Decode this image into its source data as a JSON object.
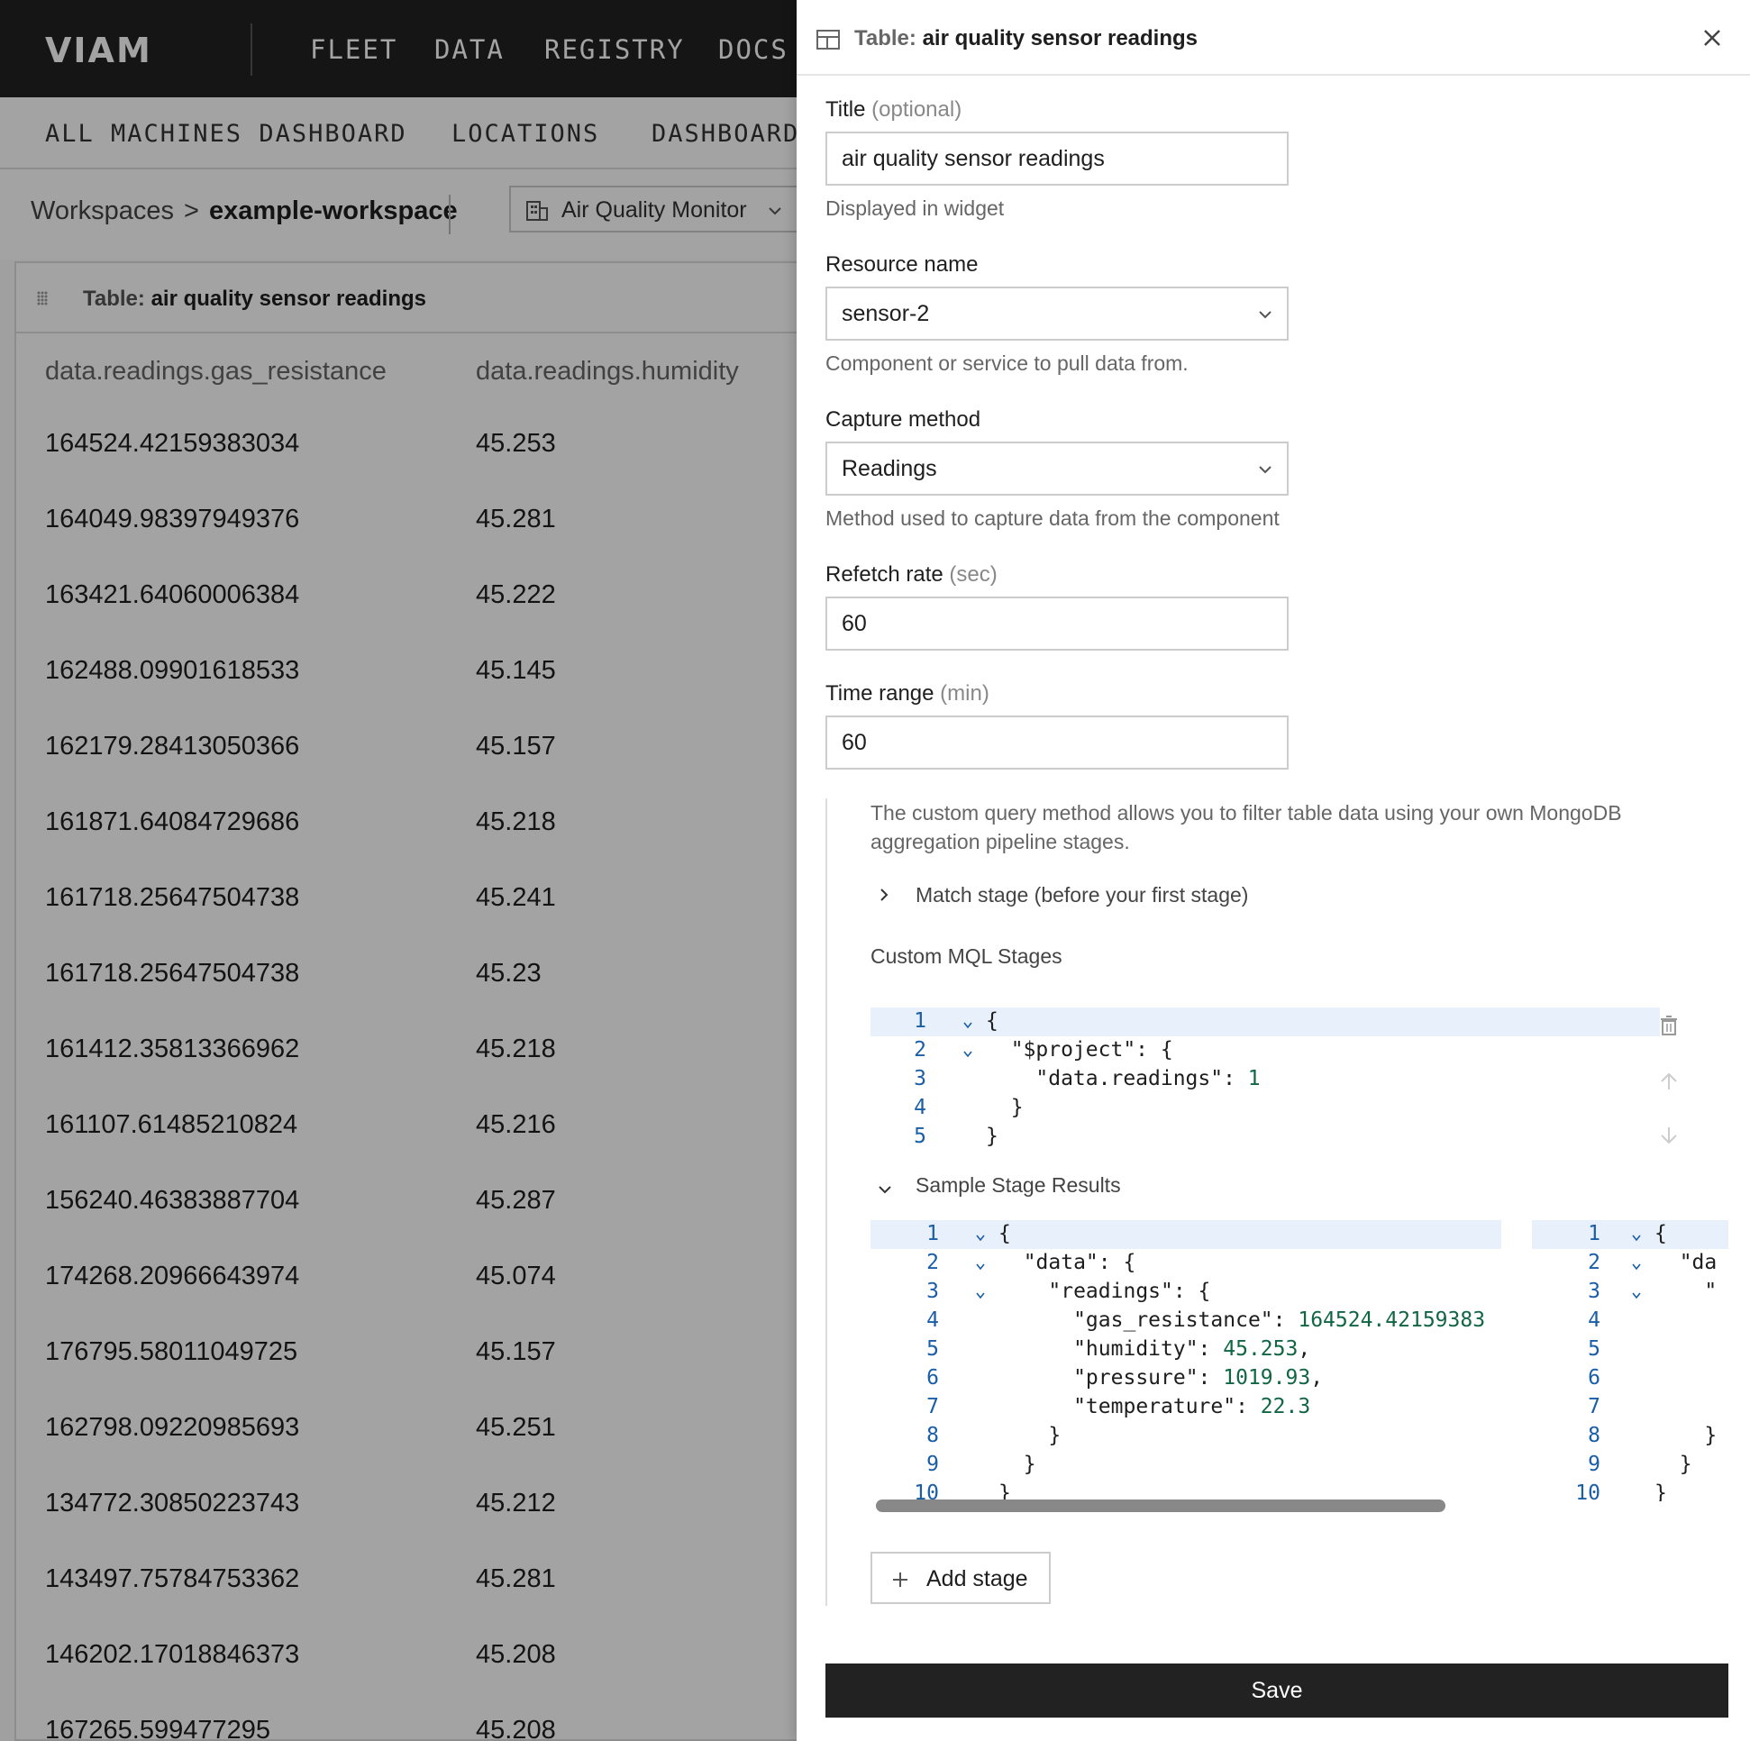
{
  "nav": {
    "logo": "VIAM",
    "items": [
      "FLEET",
      "DATA",
      "REGISTRY",
      "DOCS"
    ]
  },
  "subnav": {
    "items": [
      "ALL MACHINES DASHBOARD",
      "LOCATIONS",
      "DASHBOARD"
    ]
  },
  "breadcrumb": {
    "root": "Workspaces",
    "sep": ">",
    "current": "example-workspace",
    "machine": "Air Quality Monitor"
  },
  "widget": {
    "title_prefix": "Table:",
    "title": "air quality sensor readings",
    "columns": [
      "data.readings.gas_resistance",
      "data.readings.humidity"
    ],
    "rows": [
      [
        "164524.42159383034",
        "45.253"
      ],
      [
        "164049.98397949376",
        "45.281"
      ],
      [
        "163421.64060006384",
        "45.222"
      ],
      [
        "162488.09901618533",
        "45.145"
      ],
      [
        "162179.28413050366",
        "45.157"
      ],
      [
        "161871.64084729686",
        "45.218"
      ],
      [
        "161718.25647504738",
        "45.241"
      ],
      [
        "161718.25647504738",
        "45.23"
      ],
      [
        "161412.35813366962",
        "45.218"
      ],
      [
        "161107.61485210824",
        "45.216"
      ],
      [
        "156240.46383887704",
        "45.287"
      ],
      [
        "174268.20966643974",
        "45.074"
      ],
      [
        "176795.58011049725",
        "45.157"
      ],
      [
        "162798.09220985693",
        "45.251"
      ],
      [
        "134772.30850223743",
        "45.212"
      ],
      [
        "143497.75784753362",
        "45.281"
      ],
      [
        "146202.17018846373",
        "45.208"
      ],
      [
        "167265.599477295",
        "45.208"
      ]
    ]
  },
  "drawer": {
    "header_prefix": "Table:",
    "header_title": "air quality sensor readings",
    "title_label": "Title",
    "title_optional": "(optional)",
    "title_value": "air quality sensor readings",
    "title_hint": "Displayed in widget",
    "resource_label": "Resource name",
    "resource_value": "sensor-2",
    "resource_hint": "Component or service to pull data from.",
    "capture_label": "Capture method",
    "capture_value": "Readings",
    "capture_hint": "Method used to capture data from the component",
    "refetch_label": "Refetch rate",
    "refetch_unit": "(sec)",
    "refetch_value": "60",
    "range_label": "Time range",
    "range_unit": "(min)",
    "range_value": "60",
    "custom_desc": "The custom query method allows you to filter table data using your own MongoDB aggregation pipeline stages.",
    "match_label": "Match stage (before your first stage)",
    "stages_label": "Custom MQL Stages",
    "stage_code": [
      "{",
      "  \"$project\": {",
      "    \"data.readings\": 1",
      "  }",
      "}"
    ],
    "results_label": "Sample Stage Results",
    "result_code_left": [
      "{",
      "  \"data\": {",
      "    \"readings\": {",
      "      \"gas_resistance\": 164524.42159383",
      "      \"humidity\": 45.253,",
      "      \"pressure\": 1019.93,",
      "      \"temperature\": 22.3",
      "    }",
      "  }",
      "}"
    ],
    "result_code_right": [
      "{",
      "  \"da",
      "    \"",
      "",
      "",
      "",
      "",
      "    }",
      "  }",
      "}"
    ],
    "add_stage_label": "Add stage",
    "save_label": "Save"
  },
  "colors": {
    "nav_bg": "#222222",
    "code_line_number": "#1a5ea8",
    "code_number": "#116644",
    "save_bg": "#222222"
  }
}
